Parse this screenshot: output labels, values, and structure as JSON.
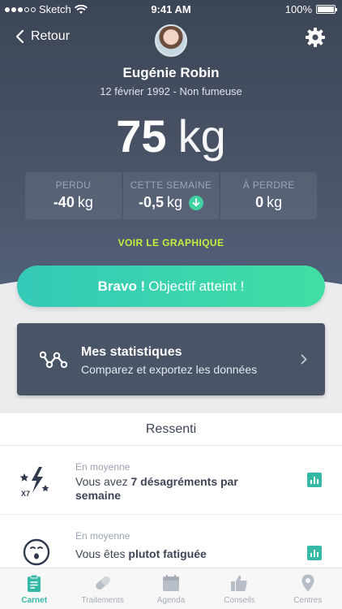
{
  "status": {
    "carrier": "Sketch",
    "time": "9:41 AM",
    "battery": "100%"
  },
  "nav": {
    "back_label": "Retour"
  },
  "profile": {
    "name": "Eugénie Robin",
    "details": "12 février 1992 - Non fumeuse"
  },
  "weight": {
    "value": "75",
    "unit": "kg"
  },
  "stats": [
    {
      "label": "PERDU",
      "value": "-40",
      "unit": "kg",
      "trend": ""
    },
    {
      "label": "CETTE SEMAINE",
      "value": "-0,5",
      "unit": "kg",
      "trend": "down"
    },
    {
      "label": "À PERDRE",
      "value": "0",
      "unit": "kg",
      "trend": ""
    }
  ],
  "graph_link": "VOIR LE GRAPHIQUE",
  "bravo": {
    "strong": "Bravo !",
    "text": "Objectif atteint !"
  },
  "statistics_card": {
    "title": "Mes statistiques",
    "subtitle": "Comparez et exportez les données"
  },
  "ressenti": {
    "title": "Ressenti",
    "items": [
      {
        "kicker": "En moyenne",
        "prefix": "Vous avez ",
        "strong": "7 désagréments par",
        "suffix": "semaine",
        "icon": "lightning-stars-icon",
        "badge": "X7"
      },
      {
        "kicker": "En moyenne",
        "prefix": "Vous êtes ",
        "strong": "plutot fatiguée",
        "suffix": "",
        "icon": "tired-face-icon"
      }
    ]
  },
  "tabs": [
    {
      "label": "Carnet",
      "active": true
    },
    {
      "label": "Traitements",
      "active": false
    },
    {
      "label": "Agenda",
      "active": false
    },
    {
      "label": "Conseils",
      "active": false
    },
    {
      "label": "Centres",
      "active": false
    }
  ],
  "colors": {
    "accent": "#35b9a6",
    "header": "#4a5467",
    "link": "#c6ef3e",
    "bravo_start": "#35c9b8",
    "bravo_end": "#41dea4"
  }
}
